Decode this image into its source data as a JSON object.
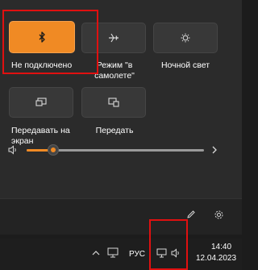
{
  "quick_settings": {
    "tiles": [
      {
        "label": "Не подключено",
        "icon": "bluetooth-icon",
        "active": true
      },
      {
        "label": "Режим \"в\nсамолете\"",
        "icon": "airplane-icon",
        "active": false
      },
      {
        "label": "Ночной свет",
        "icon": "night-light-icon",
        "active": false
      },
      {
        "label": "Передавать на\nэкран",
        "icon": "project-icon",
        "active": false
      },
      {
        "label": "Передать",
        "icon": "cast-icon",
        "active": false
      }
    ],
    "volume": {
      "level_fraction": 0.15,
      "icon": "speaker-icon"
    },
    "footer": {
      "edit_icon": "pencil-icon",
      "settings_icon": "gear-icon"
    }
  },
  "taskbar": {
    "language": "РУС",
    "time": "14:40",
    "date": "12.04.2023",
    "tray_icons": [
      "chevron-up-icon",
      "network-icon",
      "volume-icon"
    ]
  },
  "colors": {
    "accent": "#f08a24",
    "annotation": "#e01010"
  }
}
